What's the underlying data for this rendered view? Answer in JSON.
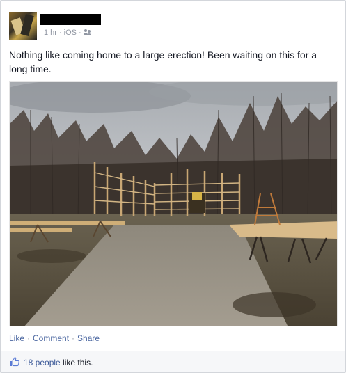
{
  "post": {
    "meta": {
      "time": "1 hr",
      "source": "iOS",
      "audience_icon": "friends-icon"
    },
    "text": "Nothing like coming home to a large erection! Been waiting on this for a long time.",
    "actions": {
      "like": "Like",
      "comment": "Comment",
      "share": "Share"
    },
    "likes": {
      "count_text": "18 people",
      "suffix": " like this.",
      "icon": "thumbs-up-icon"
    }
  }
}
